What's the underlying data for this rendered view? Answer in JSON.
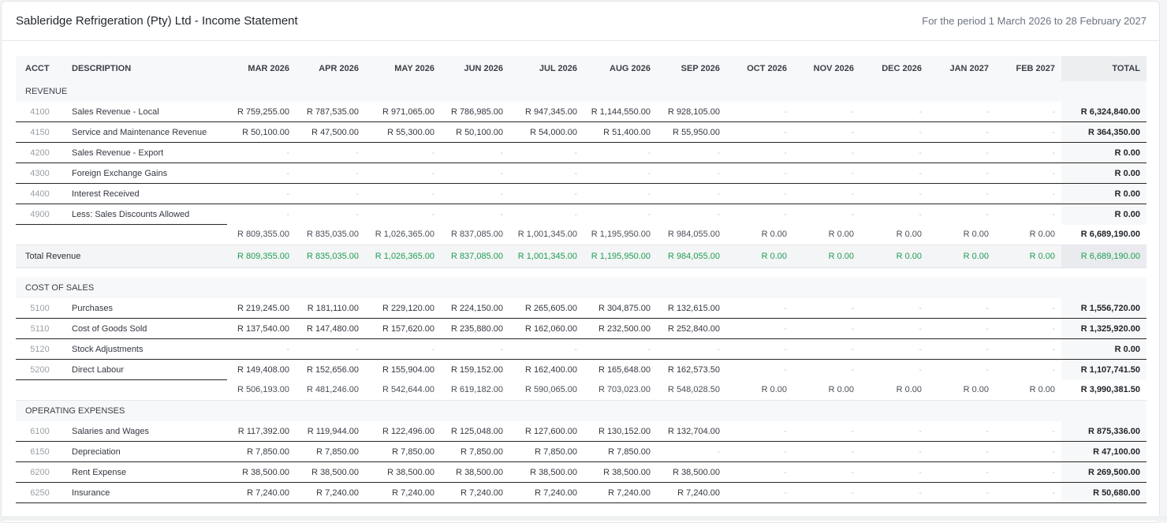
{
  "header": {
    "title": "Sableridge Refrigeration (Pty) Ltd - Income Statement",
    "period": "For the period 1 March 2026 to 28 February 2027"
  },
  "columns": {
    "acct": "ACCT",
    "description": "DESCRIPTION",
    "months": [
      "MAR 2026",
      "APR 2026",
      "MAY 2026",
      "JUN 2026",
      "JUL 2026",
      "AUG 2026",
      "SEP 2026",
      "OCT 2026",
      "NOV 2026",
      "DEC 2026",
      "JAN 2027",
      "FEB 2027"
    ],
    "total": "TOTAL"
  },
  "revenue": {
    "label": "REVENUE",
    "rows": [
      {
        "acct": "4100",
        "desc": "Sales Revenue - Local",
        "m": [
          "R 759,255.00",
          "R 787,535.00",
          "R 971,065.00",
          "R 786,985.00",
          "R 947,345.00",
          "R 1,144,550.00",
          "R 928,105.00",
          "-",
          "-",
          "-",
          "-",
          "-"
        ],
        "total": "R 6,324,840.00"
      },
      {
        "acct": "4150",
        "desc": "Service and Maintenance Revenue",
        "m": [
          "R 50,100.00",
          "R 47,500.00",
          "R 55,300.00",
          "R 50,100.00",
          "R 54,000.00",
          "R 51,400.00",
          "R 55,950.00",
          "-",
          "-",
          "-",
          "-",
          "-"
        ],
        "total": "R 364,350.00"
      },
      {
        "acct": "4200",
        "desc": "Sales Revenue - Export",
        "m": [
          "-",
          "-",
          "-",
          "-",
          "-",
          "-",
          "-",
          "-",
          "-",
          "-",
          "-",
          "-"
        ],
        "total": "R 0.00"
      },
      {
        "acct": "4300",
        "desc": "Foreign Exchange Gains",
        "m": [
          "-",
          "-",
          "-",
          "-",
          "-",
          "-",
          "-",
          "-",
          "-",
          "-",
          "-",
          "-"
        ],
        "total": "R 0.00"
      },
      {
        "acct": "4400",
        "desc": "Interest Received",
        "m": [
          "-",
          "-",
          "-",
          "-",
          "-",
          "-",
          "-",
          "-",
          "-",
          "-",
          "-",
          "-"
        ],
        "total": "R 0.00"
      },
      {
        "acct": "4900",
        "desc": "Less: Sales Discounts Allowed",
        "m": [
          "-",
          "-",
          "-",
          "-",
          "-",
          "-",
          "-",
          "-",
          "-",
          "-",
          "-",
          "-"
        ],
        "total": "R 0.00"
      }
    ],
    "subtotal": {
      "m": [
        "R 809,355.00",
        "R 835,035.00",
        "R 1,026,365.00",
        "R 837,085.00",
        "R 1,001,345.00",
        "R 1,195,950.00",
        "R 984,055.00",
        "R 0.00",
        "R 0.00",
        "R 0.00",
        "R 0.00",
        "R 0.00"
      ],
      "total": "R 6,689,190.00"
    },
    "grand": {
      "label": "Total Revenue",
      "m": [
        "R 809,355.00",
        "R 835,035.00",
        "R 1,026,365.00",
        "R 837,085.00",
        "R 1,001,345.00",
        "R 1,195,950.00",
        "R 984,055.00",
        "R 0.00",
        "R 0.00",
        "R 0.00",
        "R 0.00",
        "R 0.00"
      ],
      "total": "R 6,689,190.00"
    }
  },
  "cost_of_sales": {
    "label": "COST OF SALES",
    "rows": [
      {
        "acct": "5100",
        "desc": "Purchases",
        "m": [
          "R 219,245.00",
          "R 181,110.00",
          "R 229,120.00",
          "R 224,150.00",
          "R 265,605.00",
          "R 304,875.00",
          "R 132,615.00",
          "-",
          "-",
          "-",
          "-",
          "-"
        ],
        "total": "R 1,556,720.00"
      },
      {
        "acct": "5110",
        "desc": "Cost of Goods Sold",
        "m": [
          "R 137,540.00",
          "R 147,480.00",
          "R 157,620.00",
          "R 235,880.00",
          "R 162,060.00",
          "R 232,500.00",
          "R 252,840.00",
          "-",
          "-",
          "-",
          "-",
          "-"
        ],
        "total": "R 1,325,920.00"
      },
      {
        "acct": "5120",
        "desc": "Stock Adjustments",
        "m": [
          "-",
          "-",
          "-",
          "-",
          "-",
          "-",
          "-",
          "-",
          "-",
          "-",
          "-",
          "-"
        ],
        "total": "R 0.00"
      },
      {
        "acct": "5200",
        "desc": "Direct Labour",
        "m": [
          "R 149,408.00",
          "R 152,656.00",
          "R 155,904.00",
          "R 159,152.00",
          "R 162,400.00",
          "R 165,648.00",
          "R 162,573.50",
          "-",
          "-",
          "-",
          "-",
          "-"
        ],
        "total": "R 1,107,741.50"
      }
    ],
    "subtotal": {
      "m": [
        "R 506,193.00",
        "R 481,246.00",
        "R 542,644.00",
        "R 619,182.00",
        "R 590,065.00",
        "R 703,023.00",
        "R 548,028.50",
        "R 0.00",
        "R 0.00",
        "R 0.00",
        "R 0.00",
        "R 0.00"
      ],
      "total": "R 3,990,381.50"
    }
  },
  "operating_expenses": {
    "label": "OPERATING EXPENSES",
    "rows": [
      {
        "acct": "6100",
        "desc": "Salaries and Wages",
        "m": [
          "R 117,392.00",
          "R 119,944.00",
          "R 122,496.00",
          "R 125,048.00",
          "R 127,600.00",
          "R 130,152.00",
          "R 132,704.00",
          "-",
          "-",
          "-",
          "-",
          "-"
        ],
        "total": "R 875,336.00"
      },
      {
        "acct": "6150",
        "desc": "Depreciation",
        "m": [
          "R 7,850.00",
          "R 7,850.00",
          "R 7,850.00",
          "R 7,850.00",
          "R 7,850.00",
          "R 7,850.00",
          "-",
          "-",
          "-",
          "-",
          "-",
          "-"
        ],
        "total": "R 47,100.00"
      },
      {
        "acct": "6200",
        "desc": "Rent Expense",
        "m": [
          "R 38,500.00",
          "R 38,500.00",
          "R 38,500.00",
          "R 38,500.00",
          "R 38,500.00",
          "R 38,500.00",
          "R 38,500.00",
          "-",
          "-",
          "-",
          "-",
          "-"
        ],
        "total": "R 269,500.00"
      },
      {
        "acct": "6250",
        "desc": "Insurance",
        "m": [
          "R 7,240.00",
          "R 7,240.00",
          "R 7,240.00",
          "R 7,240.00",
          "R 7,240.00",
          "R 7,240.00",
          "R 7,240.00",
          "-",
          "-",
          "-",
          "-",
          "-"
        ],
        "total": "R 50,680.00"
      }
    ]
  }
}
